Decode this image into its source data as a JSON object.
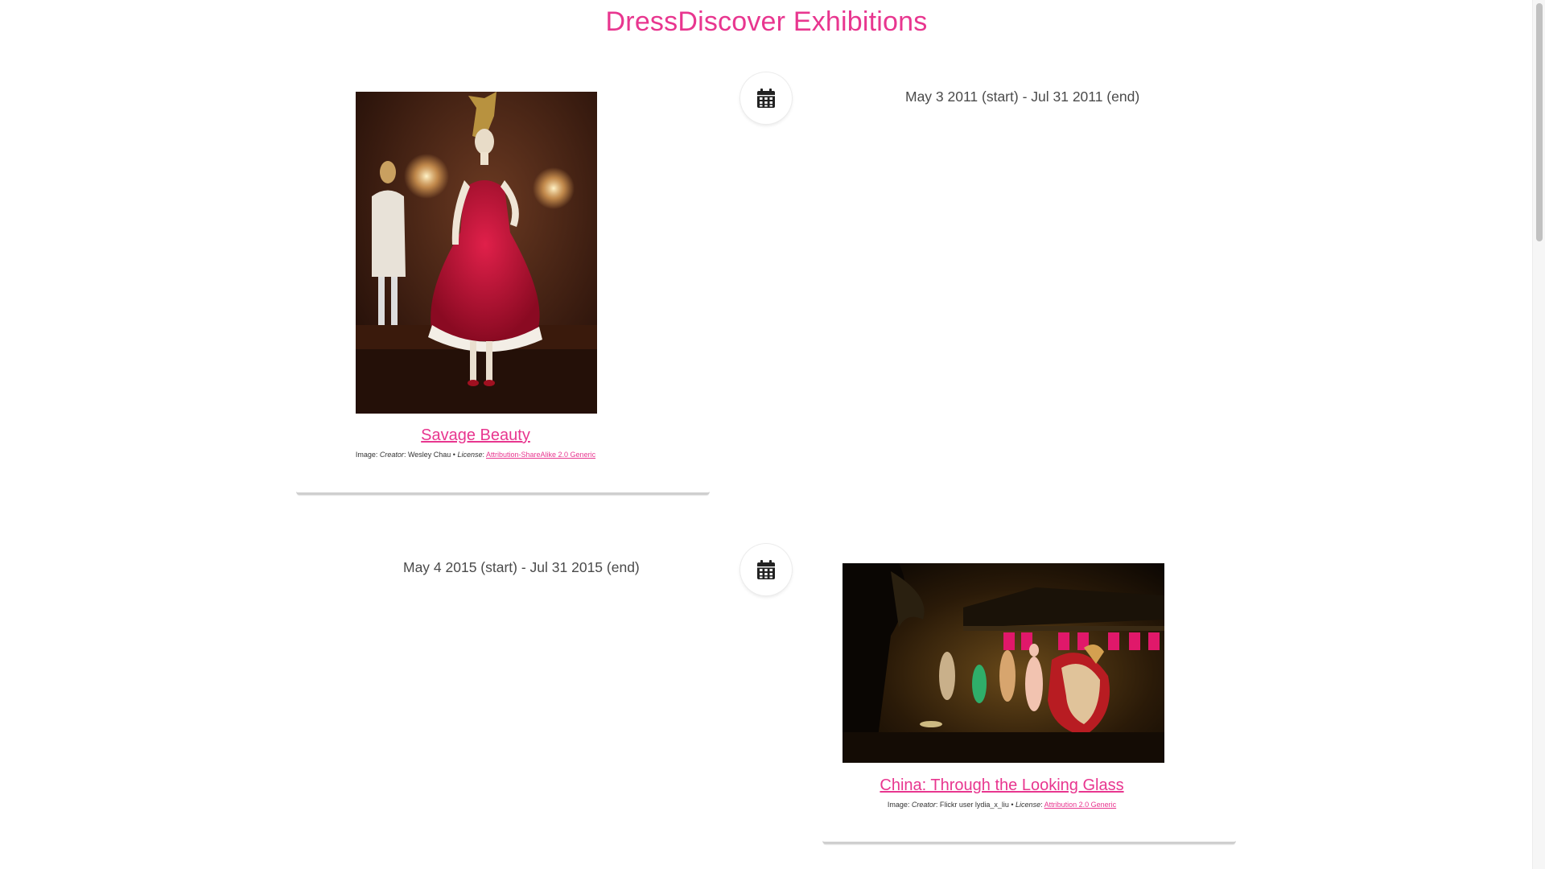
{
  "header": {
    "title": "DressDiscover Exhibitions"
  },
  "colors": {
    "accent": "#e8368f",
    "text": "#4a4a4a"
  },
  "timeline": [
    {
      "icon": "calendar-icon",
      "date": "May 3 2011 (start) - Jul 31 2011 (end)",
      "title": "Savage Beauty",
      "credit": {
        "prefix": "Image: ",
        "creator_label": "Creator",
        "creator_value": ": Wesley Chau • ",
        "license_label": "License",
        "license_sep": ": ",
        "license_link": "Attribution-ShareAlike 2.0 Generic"
      }
    },
    {
      "icon": "calendar-icon",
      "date": "May 4 2015 (start) - Jul 31 2015 (end)",
      "title": "China: Through the Looking Glass",
      "credit": {
        "prefix": "Image: ",
        "creator_label": "Creator",
        "creator_value": ": Flickr user lydia_x_liu • ",
        "license_label": "License",
        "license_sep": ": ",
        "license_link": "Attribution 2.0 Generic"
      }
    }
  ]
}
